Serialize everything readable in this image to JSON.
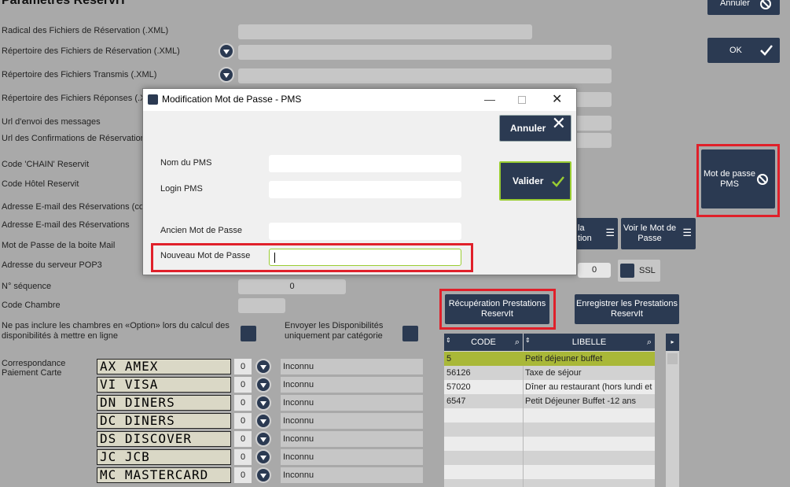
{
  "page": {
    "title": "Paramètres ReservIT"
  },
  "toolbar": {
    "annuler_label": "Annuler",
    "ok_label": "OK"
  },
  "form": {
    "radical_label": "Radical des Fichiers de Réservation (.XML)",
    "rep_reservation_label": "Répertoire des Fichiers de Réservation (.XML)",
    "rep_transmis_label": "Répertoire des Fichiers Transmis (.XML)",
    "rep_reponses_label": "Répertoire des Fichiers Réponses (.XML)",
    "url_envoi_label": "Url d'envoi des messages",
    "url_confirm_label": "Url des Confirmations de Réservations",
    "code_chain_label": "Code 'CHAIN' Reservit",
    "code_hotel_label": "Code Hôtel Reservit",
    "email_res_comp_label": "Adresse E-mail des Réservations (com",
    "email_res_label": "Adresse E-mail des Réservations",
    "mdp_mail_label": "Mot de Passe de la boite Mail",
    "pop3_label": "Adresse du serveur POP3",
    "pop3_port": "0",
    "ssl_label": "SSL",
    "sequence_label": "N° séquence",
    "sequence_value": "0",
    "code_chambre_label": "Code Chambre",
    "option_label_1": "Ne pas inclure les chambres en «Option» lors du calcul des",
    "option_label_2": "disponibilités à mettre en ligne",
    "dispo_label_1": "Envoyer les Disponibilités",
    "dispo_label_2": "uniquement par catégorie",
    "corresp_label_1": "Correspondance",
    "corresp_label_2": "Paiement Carte"
  },
  "buttons": {
    "mdp_pms_label_1": "Mot de passe",
    "mdp_pms_label_2": "PMS",
    "voir_la_label_1": "la",
    "voir_la_label_2": "tion",
    "voir_mdp_label_1": "Voir le Mot de",
    "voir_mdp_label_2": "Passe",
    "recup_label_1": "Récupération Prestations",
    "recup_label_2": "ReservIt",
    "enreg_label_1": "Enregistrer les Prestations",
    "enreg_label_2": "ReservIt"
  },
  "cards": [
    {
      "name": "AX AMEX",
      "num": "0",
      "value": "Inconnu"
    },
    {
      "name": "VI VISA",
      "num": "0",
      "value": "Inconnu"
    },
    {
      "name": "DN DINERS",
      "num": "0",
      "value": "Inconnu"
    },
    {
      "name": "DC DINERS",
      "num": "0",
      "value": "Inconnu"
    },
    {
      "name": "DS DISCOVER",
      "num": "0",
      "value": "Inconnu"
    },
    {
      "name": "JC JCB",
      "num": "0",
      "value": "Inconnu"
    },
    {
      "name": "MC MASTERCARD",
      "num": "0",
      "value": "Inconnu"
    }
  ],
  "grid": {
    "col_code": "CODE",
    "col_libelle": "LIBELLE",
    "rows": [
      {
        "code": "5",
        "libelle": "Petit déjeuner buffet"
      },
      {
        "code": "56126",
        "libelle": "Taxe de séjour"
      },
      {
        "code": "57020",
        "libelle": "Dîner au restaurant (hors lundi et"
      },
      {
        "code": "6547",
        "libelle": "Petit Déjeuner Buffet -12 ans"
      }
    ]
  },
  "dialog": {
    "title": "Modification Mot de Passe - PMS",
    "annuler_label": "Annuler",
    "valider_label": "Valider",
    "nom_pms_label": "Nom du PMS",
    "login_pms_label": "Login PMS",
    "ancien_mdp_label": "Ancien Mot de Passe",
    "nouveau_mdp_label": "Nouveau Mot de Passe",
    "nom_pms_value": "",
    "login_pms_value": "",
    "ancien_mdp_value": "",
    "nouveau_mdp_value": ""
  },
  "colors": {
    "navy": "#2b3a52",
    "highlight_red": "#e0202a",
    "selected_row": "#a9b838",
    "check_green": "#9acd32"
  }
}
